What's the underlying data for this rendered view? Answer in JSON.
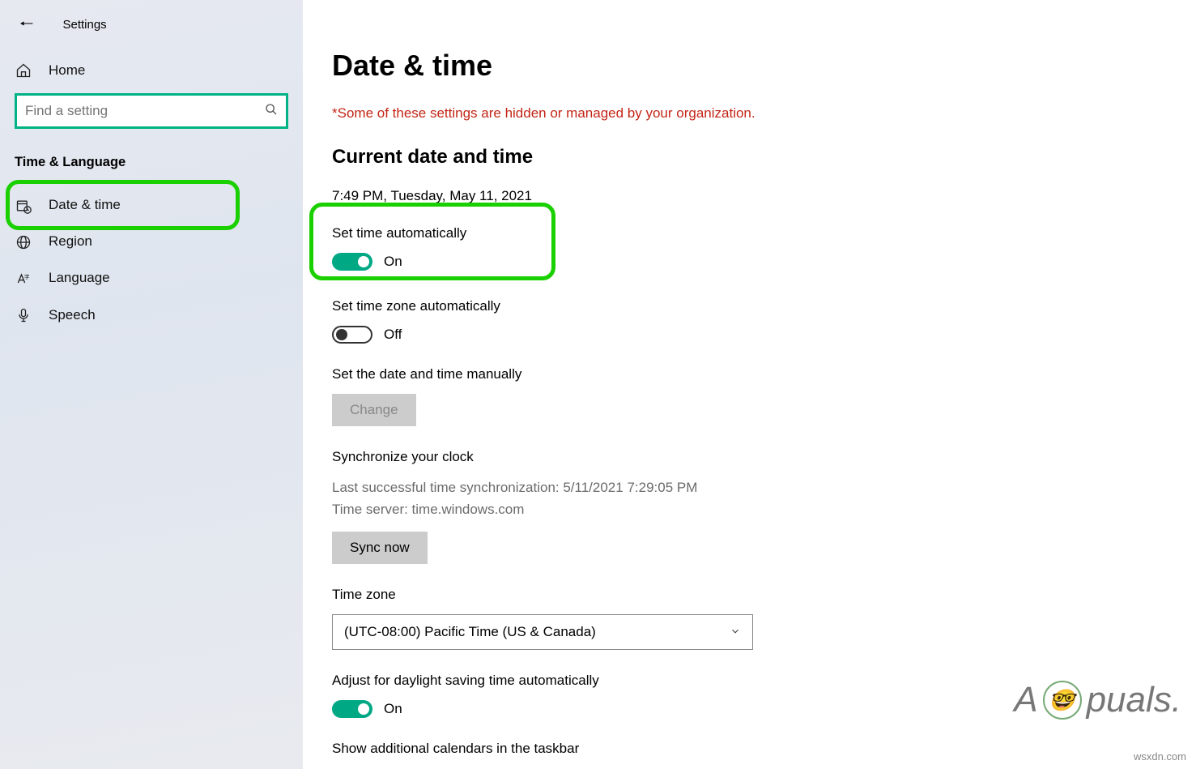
{
  "app_title": "Settings",
  "search_placeholder": "Find a setting",
  "home_label": "Home",
  "category_label": "Time & Language",
  "nav": {
    "date_time": "Date & time",
    "region": "Region",
    "language": "Language",
    "speech": "Speech"
  },
  "page_title": "Date & time",
  "org_warning": "*Some of these settings are hidden or managed by your organization.",
  "section_current": "Current date and time",
  "current_datetime": "7:49 PM, Tuesday, May 11, 2021",
  "set_time_auto": {
    "label": "Set time automatically",
    "state": "On"
  },
  "set_tz_auto": {
    "label": "Set time zone automatically",
    "state": "Off"
  },
  "manual": {
    "label": "Set the date and time manually",
    "button": "Change"
  },
  "sync": {
    "title": "Synchronize your clock",
    "last_success": "Last successful time synchronization: 5/11/2021 7:29:05 PM",
    "server": "Time server: time.windows.com",
    "button": "Sync now"
  },
  "tz": {
    "label": "Time zone",
    "value": "(UTC-08:00) Pacific Time (US & Canada)"
  },
  "dst": {
    "label": "Adjust for daylight saving time automatically",
    "state": "On"
  },
  "extra_calendars_label": "Show additional calendars in the taskbar",
  "watermark": "A   puals.",
  "siteurl": "wsxdn.com"
}
